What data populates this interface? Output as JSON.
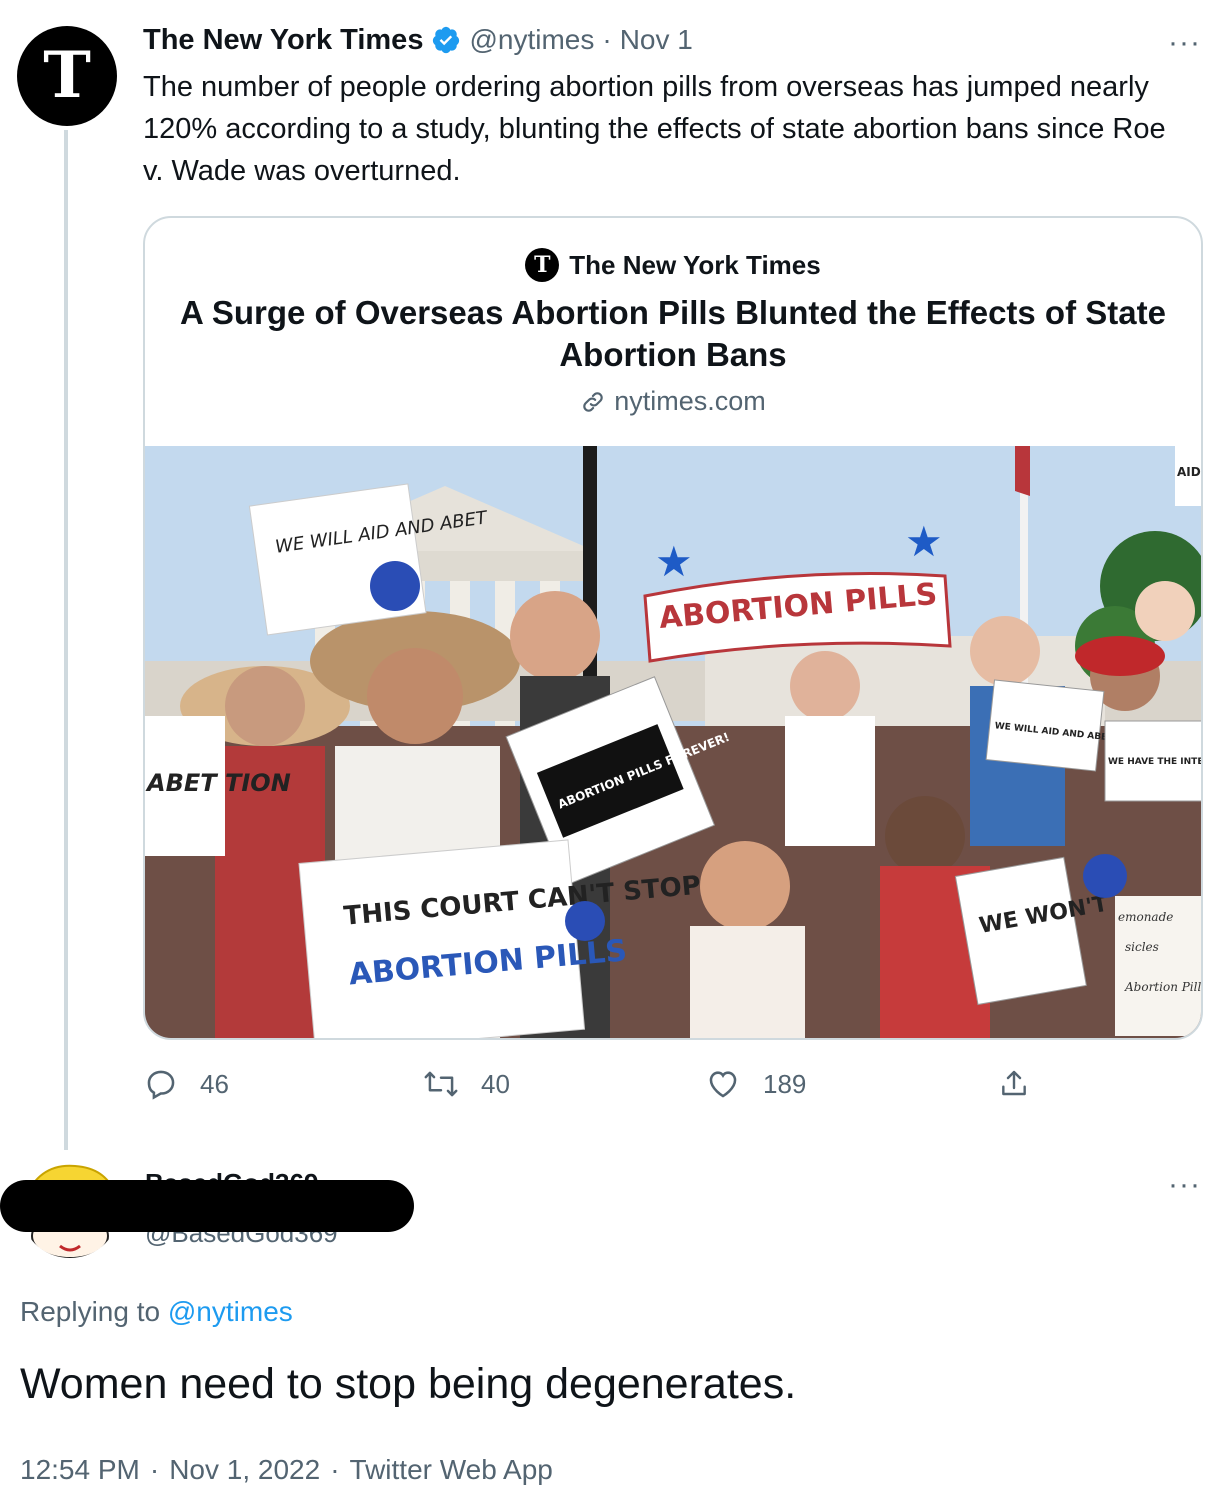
{
  "tweet": {
    "avatar_glyph": "T",
    "author_name": "The New York Times",
    "verified_icon": "verified-badge-icon",
    "handle": "@nytimes",
    "separator": "·",
    "date": "Nov 1",
    "more": "···",
    "text": "The number of people ordering abortion pills from overseas has jumped nearly 120% according to a study, blunting the effects of state abortion bans since Roe v. Wade was overturned."
  },
  "card": {
    "logo_glyph": "T",
    "source": "The New York Times",
    "title": "A Surge of Overseas Abortion Pills Blunted the Effects of State Abortion Bans",
    "link_icon": "link-icon",
    "domain": "nytimes.com",
    "image": {
      "signs": {
        "abortion_pills_banner": "ABORTION PILLS",
        "we_will_aid": "WE WILL AID AND ABET",
        "abortion_pills_forever": "ABORTION PILLS FOREVER!",
        "this_court": "THIS COURT CAN'T STOP",
        "abortion_pills_big": "ABORTION PILLS",
        "we_will_aid_abet_abortion": "WE WILL AID AND ABET ABORTION",
        "we_have_internet": "WE HAVE THE INTERNET",
        "we_wont": "WE WON'T",
        "left_edge": "ABET TION",
        "aid_corner": "AID AB",
        "lemonade": "emonade",
        "popsicles": "sicles",
        "abortion_pills_menu": "Abortion Pills"
      }
    }
  },
  "actions": {
    "reply_count": "46",
    "retweet_count": "40",
    "like_count": "189"
  },
  "reply": {
    "author_name_partial": "BasedGod369",
    "handle_partial": "@BasedGod369",
    "more": "···",
    "replying_prefix": "Replying to",
    "replying_handle": "@nytimes",
    "text": "Women need to stop being degenerates.",
    "time": "12:54 PM",
    "separator": "·",
    "date": "Nov 1, 2022",
    "client": "Twitter Web App"
  },
  "colors": {
    "link_blue": "#1d9bf0",
    "secondary_text": "#536471",
    "primary_text": "#0f1419",
    "border": "#cfd9de"
  }
}
